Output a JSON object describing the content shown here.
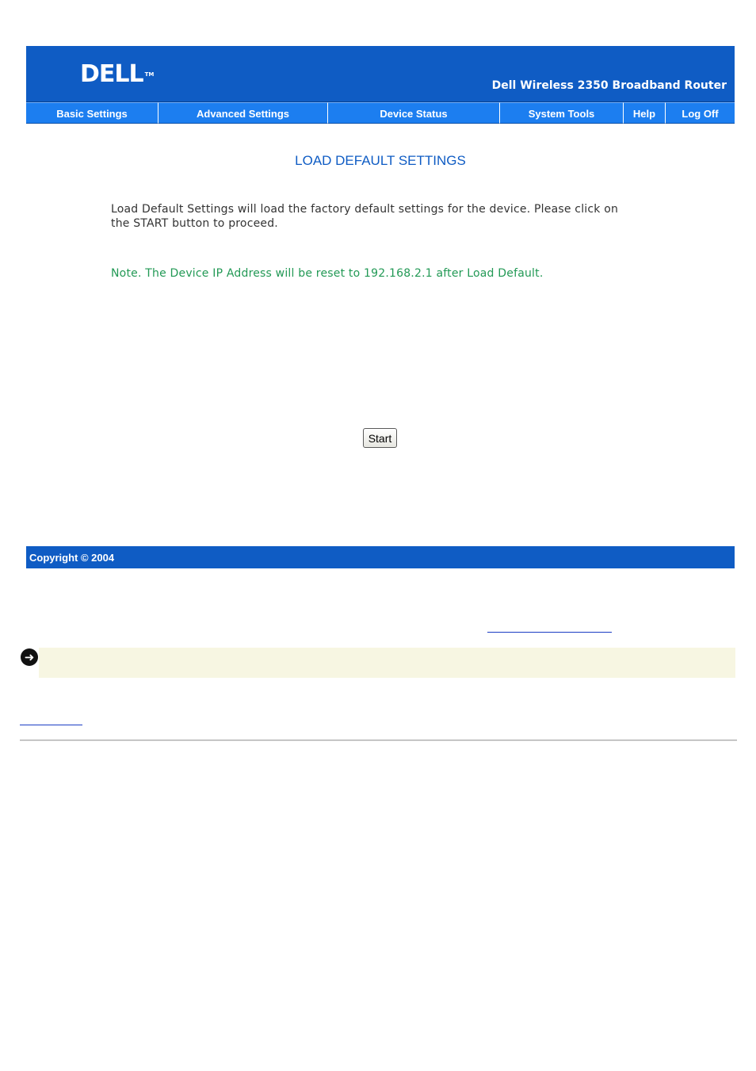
{
  "header": {
    "logo_text": "DELL",
    "logo_tm": "TM",
    "product_title": "Dell Wireless 2350 Broadband Router"
  },
  "nav": {
    "items": [
      {
        "label": "Basic Settings"
      },
      {
        "label": "Advanced Settings"
      },
      {
        "label": "Device Status"
      },
      {
        "label": "System Tools"
      },
      {
        "label": "Help"
      },
      {
        "label": "Log Off"
      }
    ]
  },
  "main": {
    "title": "LOAD DEFAULT SETTINGS",
    "description": "Load Default Settings will load the factory default settings for the device. Please click on the START button to proceed.",
    "note": "Note. The Device IP Address will be reset to 192.168.2.1 after Load Default.",
    "start_label": "Start"
  },
  "footer": {
    "copyright": "Copyright © 2004"
  },
  "colors": {
    "brand_blue": "#0f5cc4",
    "nav_blue": "#1c7ef0",
    "note_green": "#229955",
    "notice_bg": "#f7f6e2"
  },
  "icons": {
    "notice": "arrow-right-circle-icon"
  }
}
